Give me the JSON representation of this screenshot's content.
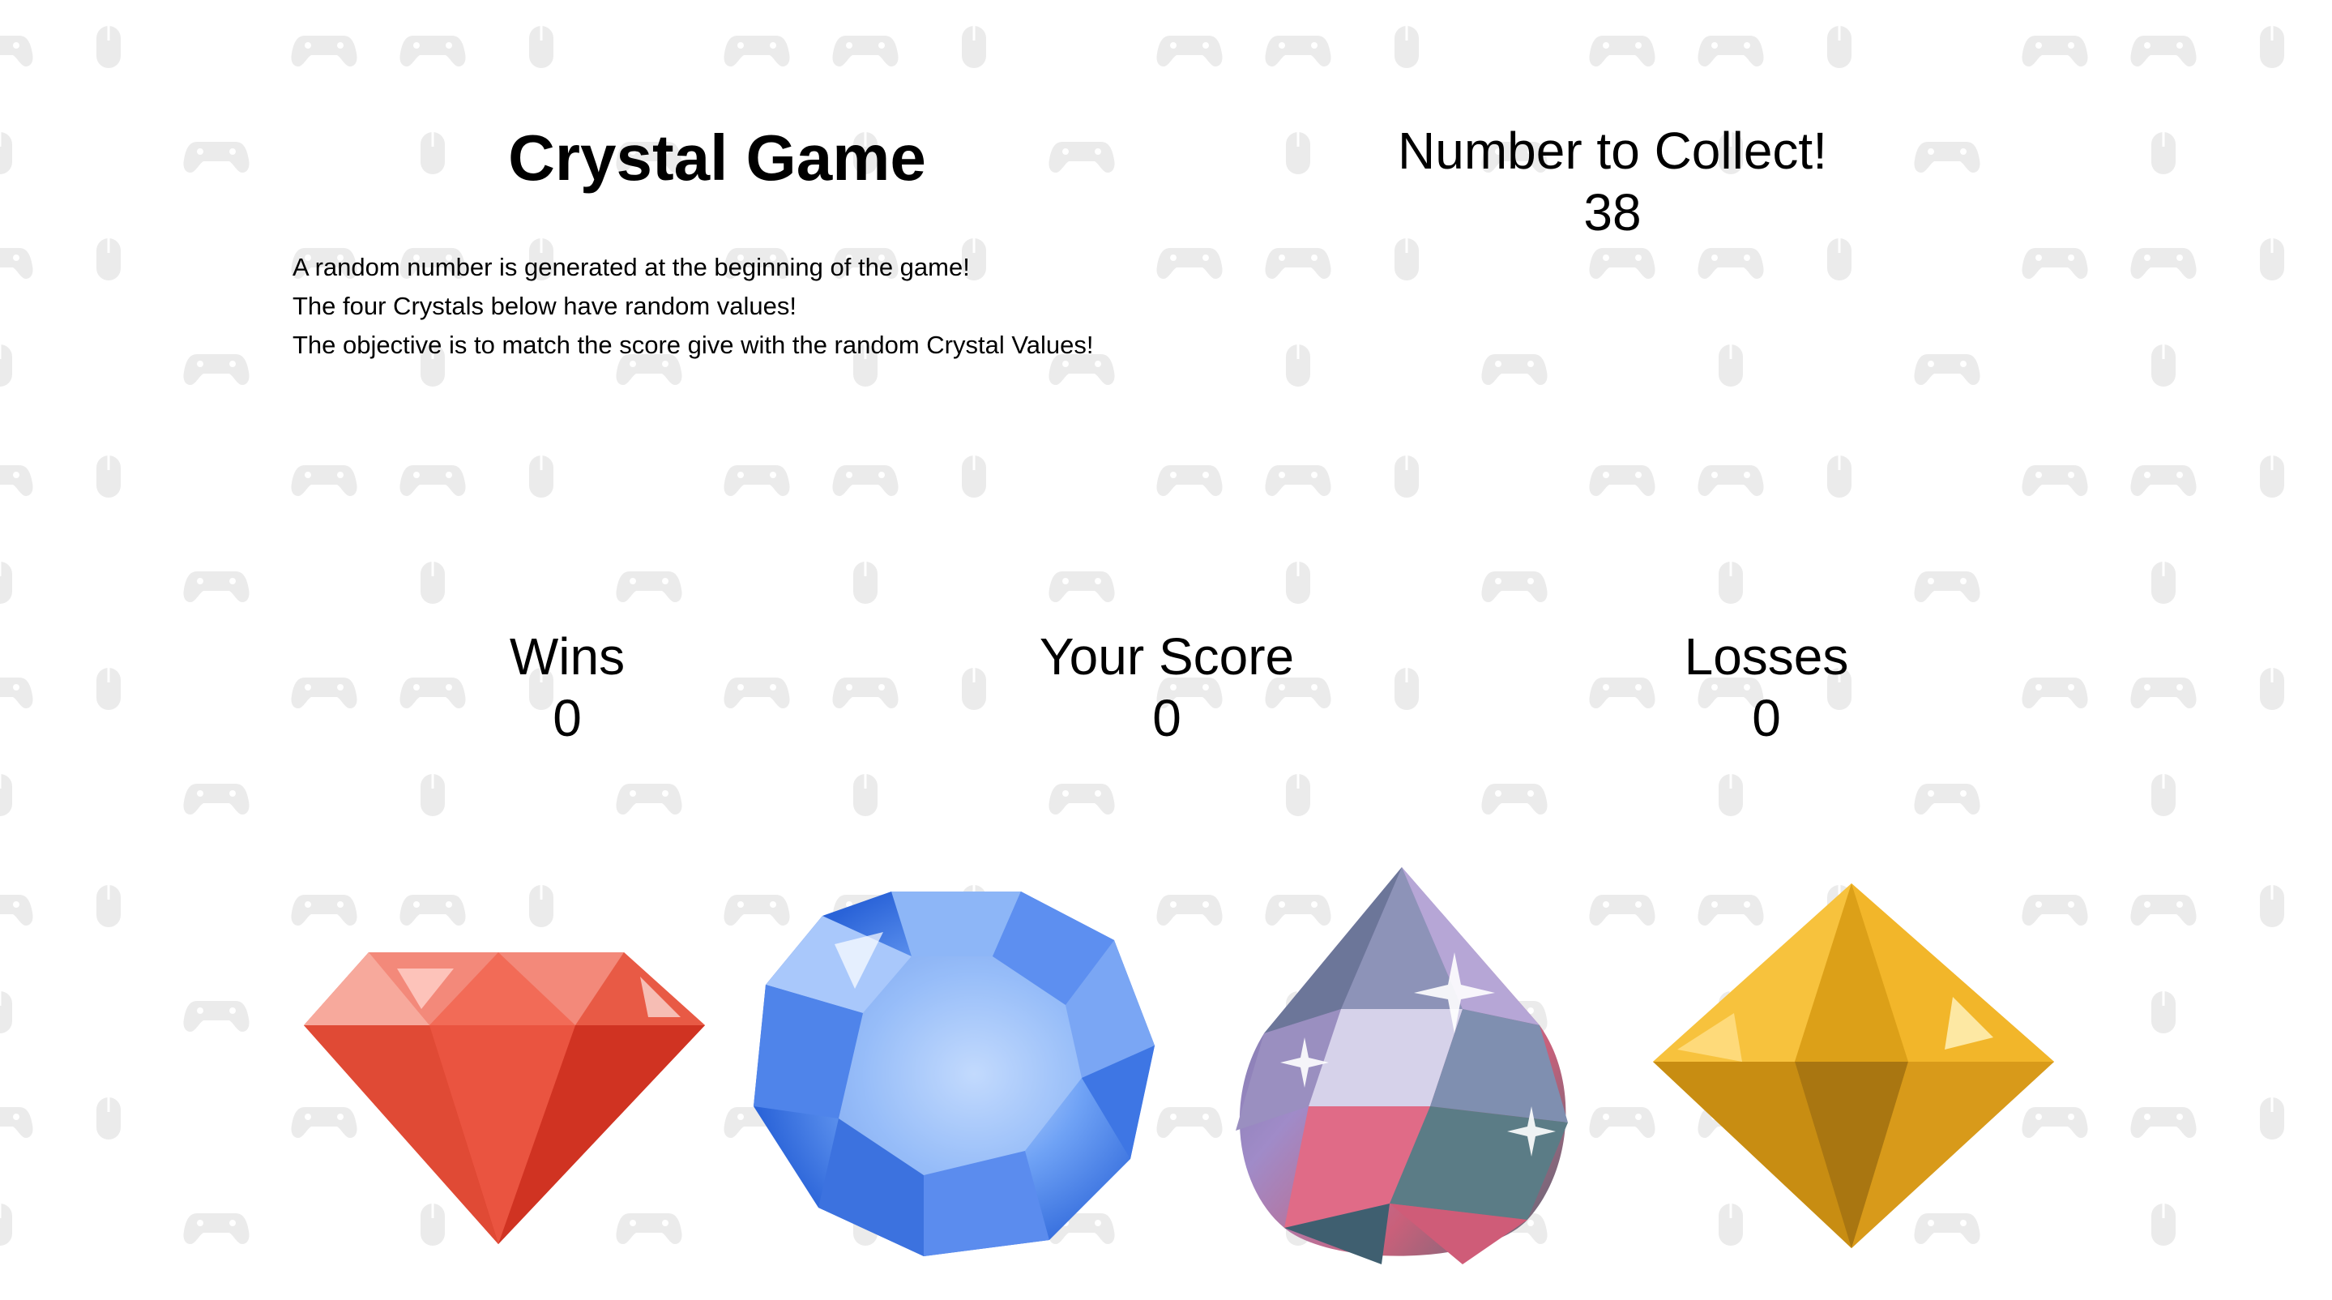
{
  "game": {
    "title": "Crystal Game",
    "instructions": [
      "A random number is generated at the beginning of the game!",
      "The four Crystals below have random values!",
      "The objective is to match the score give with the random Crystal Values!"
    ]
  },
  "target": {
    "label": "Number to Collect!",
    "value": "38"
  },
  "stats": {
    "wins_label": "Wins",
    "wins_value": "0",
    "score_label": "Your Score",
    "score_value": "0",
    "losses_label": "Losses",
    "losses_value": "0"
  },
  "crystals": [
    {
      "name": "red-crystal",
      "color": "#e8412c"
    },
    {
      "name": "blue-crystal",
      "color": "#3f7fe8"
    },
    {
      "name": "prism-crystal",
      "color": "#8a7fb0"
    },
    {
      "name": "gold-crystal",
      "color": "#e6a51a"
    }
  ],
  "background": {
    "pattern_icons": [
      "gamepad-icon",
      "mouse-icon"
    ],
    "pattern_color": "#ececec"
  }
}
